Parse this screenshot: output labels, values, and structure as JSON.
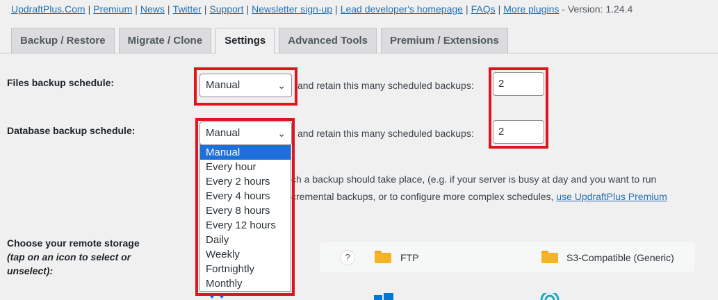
{
  "toplinks": {
    "links": [
      "UpdraftPlus.Com",
      "Premium",
      "News",
      "Twitter",
      "Support",
      "Newsletter sign-up",
      "Lead developer's homepage",
      "FAQs",
      "More plugins"
    ],
    "version": "- Version: 1.24.4"
  },
  "tabs": [
    "Backup / Restore",
    "Migrate / Clone",
    "Settings",
    "Advanced Tools",
    "Premium / Extensions"
  ],
  "active_tab": "Settings",
  "files": {
    "label": "Files backup schedule:",
    "value": "Manual",
    "retain_text": "and retain this many scheduled backups:",
    "retain_value": "2"
  },
  "database": {
    "label": "Database backup schedule:",
    "value": "Manual",
    "retain_text": "and retain this many scheduled backups:",
    "retain_value": "2"
  },
  "dropdown": {
    "options": [
      "Manual",
      "Every hour",
      "Every 2 hours",
      "Every 4 hours",
      "Every 8 hours",
      "Every 12 hours",
      "Daily",
      "Weekly",
      "Fortnightly",
      "Monthly"
    ],
    "selected": "Manual"
  },
  "help": {
    "line1": "ch a backup should take place, (e.g. if your server is busy at day and you want to run",
    "line2": "cremental backups, or to configure more complex schedules,",
    "link": "use UpdraftPlus Premium"
  },
  "storage": {
    "label_line1": "Choose your remote storage",
    "label_line2": "(tap on an icon to select or",
    "label_line3": "unselect):",
    "help_icon": "?",
    "options": [
      "FTP",
      "S3-Compatible (Generic)"
    ]
  },
  "colors": {
    "link": "#2271b1",
    "highlight": "#e0141e",
    "selected_option": "#1e6fd9",
    "folder": "#f5b325"
  }
}
